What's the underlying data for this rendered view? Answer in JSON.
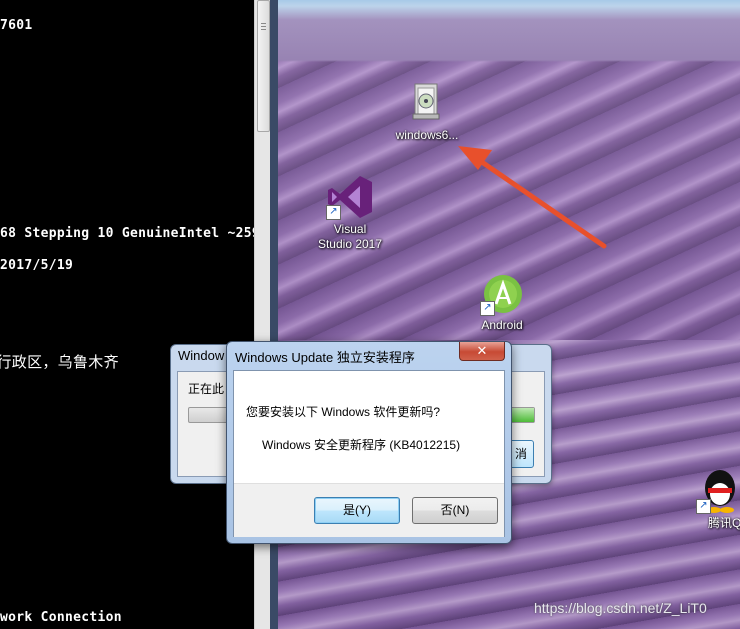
{
  "console": {
    "lines": [
      {
        "text": "7601"
      },
      {
        "text": "68 Stepping 10 GenuineIntel ~259"
      },
      {
        "text": "2017/5/19"
      },
      {
        "text": "l行政区，乌鲁木齐"
      },
      {
        "text": "work Connection"
      }
    ]
  },
  "desktop": {
    "icons": [
      {
        "label": "windows6...",
        "icon": "installer-package-icon"
      },
      {
        "label": "Visual\nStudio 2017",
        "icon": "visual-studio-icon"
      },
      {
        "label": "Android",
        "icon": "android-studio-icon"
      },
      {
        "label": "腾讯Q",
        "icon": "qq-penguin-icon"
      }
    ],
    "watermark": "https://blog.csdn.net/Z_LiT0"
  },
  "back_dialog": {
    "title": "Window",
    "subtitle": "正在此",
    "button": "消",
    "progress_percent": 92
  },
  "dialog": {
    "title": "Windows Update 独立安装程序",
    "close_label": "✕",
    "question": "您要安装以下 Windows 软件更新吗?",
    "update_name": "Windows 安全更新程序 (KB4012215)",
    "yes_label": "是(Y)",
    "no_label": "否(N)"
  },
  "colors": {
    "annotation_arrow": "#e8502c",
    "dialog_title_bg": "#bcd3ef",
    "close_button": "#c74a34"
  }
}
